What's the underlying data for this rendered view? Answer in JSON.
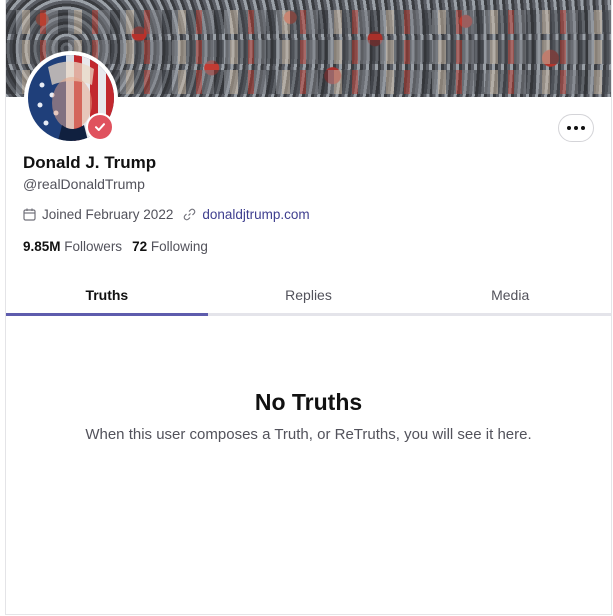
{
  "profile": {
    "display_name": "Donald J. Trump",
    "handle": "@realDonaldTrump",
    "joined": "Joined February 2022",
    "website": "donaldjtrump.com",
    "followers_count": "9.85M",
    "followers_label": "Followers",
    "following_count": "72",
    "following_label": "Following",
    "verified_icon": "verified-check-icon",
    "more_icon": "more-horizontal-icon"
  },
  "tabs": [
    {
      "label": "Truths",
      "active": true
    },
    {
      "label": "Replies",
      "active": false
    },
    {
      "label": "Media",
      "active": false
    }
  ],
  "empty_state": {
    "title": "No Truths",
    "message": "When this user composes a Truth, or ReTruths, you will see it here."
  },
  "colors": {
    "accent": "#5e5cad",
    "verified": "#e0525e",
    "link": "#3f3f8f"
  }
}
